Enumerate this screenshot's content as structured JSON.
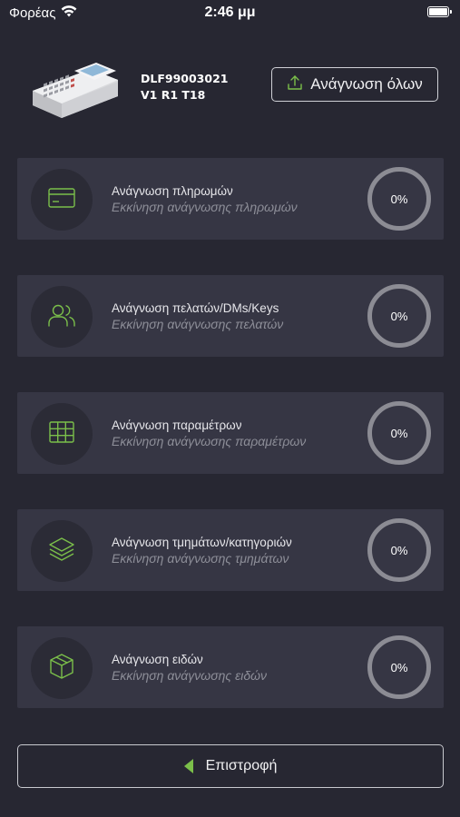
{
  "status_bar": {
    "carrier": "Φορέας",
    "time": "2:46 μμ",
    "icons": [
      "wifi-icon",
      "battery-icon"
    ]
  },
  "header": {
    "device_image": "fiscal-cash-register-image",
    "serial": "DLF99003021",
    "version": "V1 R1 T18",
    "read_all_label": "Ανάγνωση όλων",
    "read_all_icon": "upload-icon"
  },
  "accent_color": "#7bbf4a",
  "cards": [
    {
      "icon": "credit-card-icon",
      "title": "Ανάγνωση πληρωμών",
      "subtitle": "Εκκίνηση ανάγνωσης πληρωμών",
      "progress": "0%"
    },
    {
      "icon": "users-icon",
      "title": "Ανάγνωση πελατών/DMs/Keys",
      "subtitle": "Εκκίνηση ανάγνωσης πελατών",
      "progress": "0%"
    },
    {
      "icon": "grid-icon",
      "title": "Ανάγνωση παραμέτρων",
      "subtitle": "Εκκίνηση ανάγνωσης παραμέτρων",
      "progress": "0%"
    },
    {
      "icon": "layers-icon",
      "title": "Ανάγνωση τμημάτων/κατηγοριών",
      "subtitle": "Εκκίνηση ανάγνωσης τμημάτων",
      "progress": "0%"
    },
    {
      "icon": "box-icon",
      "title": "Ανάγνωση ειδών",
      "subtitle": "Εκκίνηση ανάγνωσης ειδών",
      "progress": "0%"
    }
  ],
  "footer": {
    "back_label": "Επιστροφή",
    "back_icon": "back-arrow-icon"
  }
}
